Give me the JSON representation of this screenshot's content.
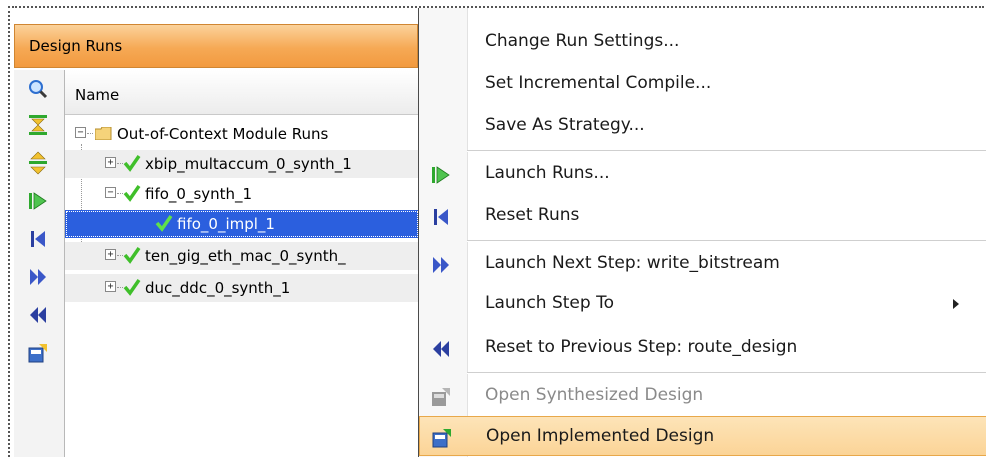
{
  "panel": {
    "title": "Design Runs",
    "column_name": "Name"
  },
  "toolbar": {
    "icons": [
      "search-icon",
      "collapse-all-icon",
      "expand-all-icon",
      "launch-runs-icon",
      "reset-runs-icon",
      "launch-next-step-icon",
      "reset-previous-step-icon",
      "open-design-icon"
    ]
  },
  "tree": {
    "root": "Out-of-Context Module Runs",
    "items": [
      {
        "label": "xbip_multaccum_0_synth_1",
        "status": "complete"
      },
      {
        "label": "fifo_0_synth_1",
        "status": "complete"
      },
      {
        "label": "fifo_0_impl_1",
        "status": "complete",
        "selected": true
      },
      {
        "label": "ten_gig_eth_mac_0_synth_",
        "status": "complete"
      },
      {
        "label": "duc_ddc_0_synth_1",
        "status": "complete"
      }
    ]
  },
  "menu": {
    "change_run_settings": "Change Run Settings...",
    "set_incremental": "Set Incremental Compile...",
    "save_strategy": "Save As Strategy...",
    "launch_runs": "Launch Runs...",
    "reset_runs": "Reset Runs",
    "launch_next_step": "Launch Next Step: write_bitstream",
    "launch_step_to": "Launch Step To",
    "reset_previous": "Reset to Previous Step: route_design",
    "open_synthesized": "Open Synthesized Design",
    "open_implemented": "Open Implemented Design"
  },
  "colors": {
    "header_orange": "#f6a955",
    "selection_blue": "#2b5fde",
    "check_green": "#3fbf2a",
    "icon_green": "#2ea82e",
    "icon_blue": "#2b3fa0"
  }
}
